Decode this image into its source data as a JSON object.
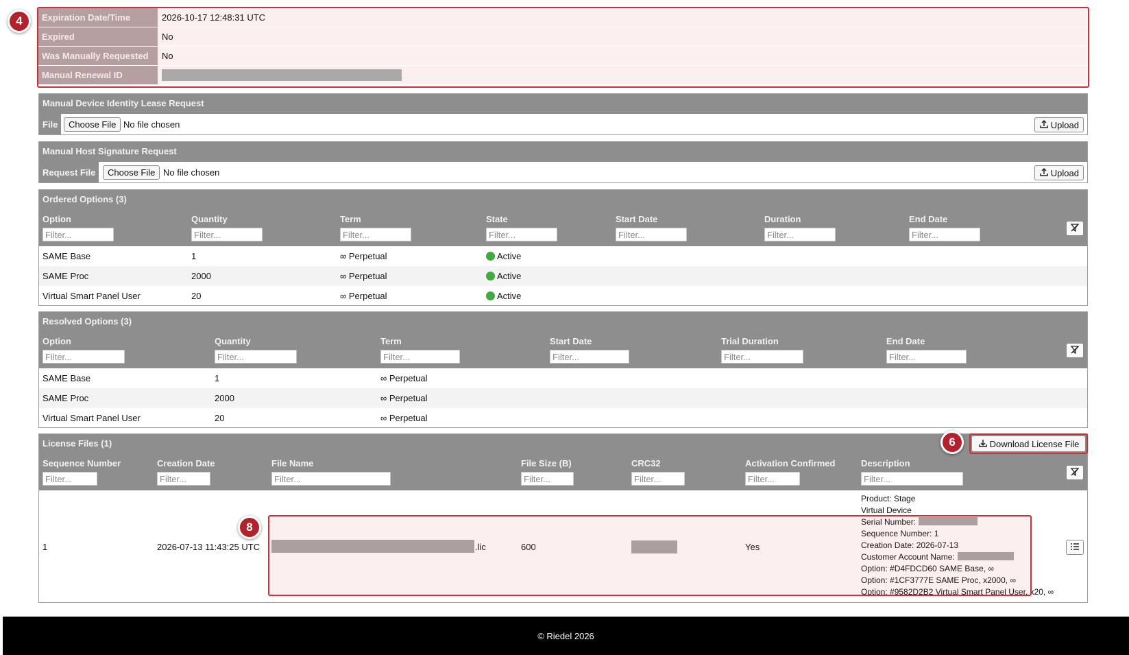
{
  "markers": {
    "m4": "4",
    "m6": "6",
    "m8": "8"
  },
  "details": {
    "rows": [
      {
        "label": "Expiration Date/Time",
        "value": "2026-10-17 12:48:31 UTC"
      },
      {
        "label": "Expired",
        "value": "No"
      },
      {
        "label": "Was Manually Requested",
        "value": "No"
      },
      {
        "label": "Manual Renewal ID",
        "value": ""
      }
    ]
  },
  "lease_request": {
    "title": "Manual Device Identity Lease Request",
    "file_label": "File",
    "choose_label": "Choose File",
    "no_file": "No file chosen",
    "upload_label": "Upload"
  },
  "host_request": {
    "title": "Manual Host Signature Request",
    "file_label": "Request File",
    "choose_label": "Choose File",
    "no_file": "No file chosen",
    "upload_label": "Upload"
  },
  "filter_placeholder": "Filter...",
  "ordered": {
    "title": "Ordered Options (3)",
    "columns": [
      "Option",
      "Quantity",
      "Term",
      "State",
      "Start Date",
      "Duration",
      "End Date"
    ],
    "rows": [
      {
        "option": "SAME Base",
        "quantity": "1",
        "term": "Perpetual",
        "state": "Active"
      },
      {
        "option": "SAME Proc",
        "quantity": "2000",
        "term": "Perpetual",
        "state": "Active"
      },
      {
        "option": "Virtual Smart Panel User",
        "quantity": "20",
        "term": "Perpetual",
        "state": "Active"
      }
    ]
  },
  "resolved": {
    "title": "Resolved Options (3)",
    "columns": [
      "Option",
      "Quantity",
      "Term",
      "Start Date",
      "Trial Duration",
      "End Date"
    ],
    "rows": [
      {
        "option": "SAME Base",
        "quantity": "1",
        "term": "Perpetual"
      },
      {
        "option": "SAME Proc",
        "quantity": "2000",
        "term": "Perpetual"
      },
      {
        "option": "Virtual Smart Panel User",
        "quantity": "20",
        "term": "Perpetual"
      }
    ]
  },
  "license": {
    "title": "License Files (1)",
    "download_label": "Download License File",
    "columns": [
      "Sequence Number",
      "Creation Date",
      "File Name",
      "File Size (B)",
      "CRC32",
      "Activation Confirmed",
      "Description"
    ],
    "row": {
      "sequence": "1",
      "created": "2026-07-13 11:43:25 UTC",
      "file_ext": ".lic",
      "size": "600",
      "activation": "Yes",
      "description": [
        "Product: Stage",
        "Virtual Device",
        "Serial Number:",
        "Sequence Number: 1",
        "Creation Date: 2026-07-13",
        "Customer Account Name:",
        "Option: #D4FDCD60 SAME Base,",
        "Option: #1CF3777E SAME Proc, x2000,",
        "Option: #9582D2B2 Virtual Smart Panel User, x20,"
      ]
    }
  },
  "footer": {
    "text": "© Riedel 2026"
  },
  "colors": {
    "header_gray": "#8e8e8e",
    "highlight_red": "#c8303a",
    "marker_red": "#b2222c",
    "active_green": "#3fab3f"
  }
}
